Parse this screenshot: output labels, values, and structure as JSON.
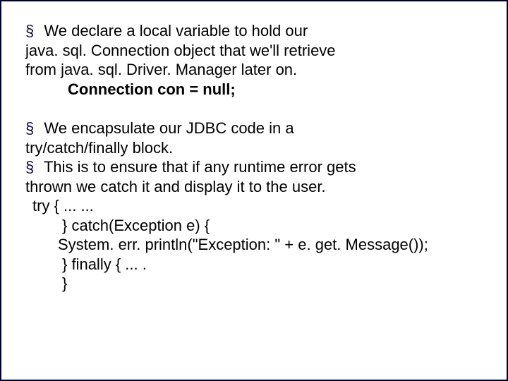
{
  "b1": {
    "line1_pre_bullet": "§",
    "line1": "We declare a local variable to hold our",
    "line2": "java. sql. Connection object that we'll  retrieve",
    "line3": "from java. sql. Driver. Manager later on.",
    "code": "Connection con = null;"
  },
  "b2": {
    "bullet1": "§",
    "line1": "We encapsulate our JDBC code in a",
    "line2": "try/catch/finally block.",
    "bullet2": "§",
    "line3": "This is to ensure that if any runtime error gets",
    "line4": "thrown we catch it and display it to the user.",
    "code1": " try { ... ...",
    "code2": "} catch(Exception e)     {",
    "code3": "System. err. println(\"Exception: \" + e. get. Message());",
    "code4": "}  finally   { ... . ",
    "code5": "}"
  }
}
